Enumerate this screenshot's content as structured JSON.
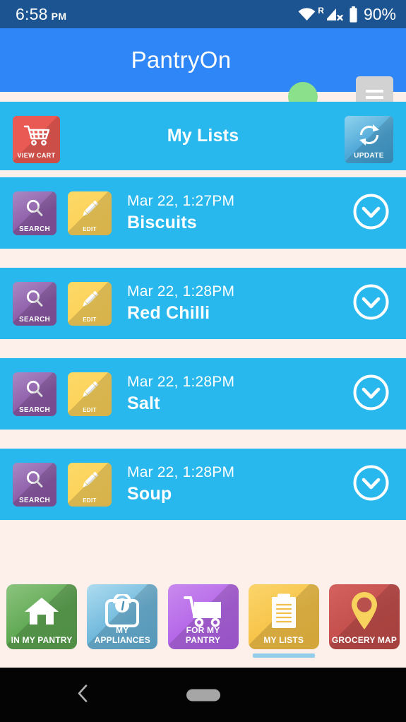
{
  "status_bar": {
    "time": "6:58",
    "ampm": "PM",
    "battery_percent": "90%",
    "wifi_icon": "wifi-icon",
    "roaming_label": "R",
    "signal_icon": "signal-off-icon",
    "battery_icon": "battery-icon",
    "background_color": "#1B5490"
  },
  "title_bar": {
    "app_name": "PantryOn",
    "status_dot_color": "#8BE08B",
    "menu_icon": "hamburger-menu-icon",
    "background_color": "#2E86F7"
  },
  "section_header": {
    "title": "My Lists",
    "background_color": "#28B8EE",
    "view_cart": {
      "label": "VIEW CART",
      "icon": "shopping-cart-icon",
      "color": "#EA5A54"
    },
    "update": {
      "label": "UPDATE",
      "icon": "refresh-sync-icon",
      "color": "#4FA8D8"
    }
  },
  "lists": {
    "row_action_search": {
      "label": "SEARCH",
      "icon": "magnifier-icon"
    },
    "row_action_edit": {
      "label": "EDIT",
      "icon": "pen-icon"
    },
    "expand_icon": "chevron-down-circle-icon",
    "items": [
      {
        "date": "Mar 22, 1:27PM",
        "name": "Biscuits"
      },
      {
        "date": "Mar 22, 1:28PM",
        "name": "Red Chilli"
      },
      {
        "date": "Mar 22, 1:28PM",
        "name": "Salt"
      },
      {
        "date": "Mar 22, 1:28PM",
        "name": "Soup"
      }
    ]
  },
  "tab_bar": {
    "active_index": 3,
    "active_indicator_color": "#93CDE8",
    "tabs": [
      {
        "label": "IN MY PANTRY",
        "icon": "house-icon",
        "color": "#5FA853"
      },
      {
        "label": "MY APPLIANCES",
        "icon": "weight-scale-icon",
        "color": "#6FB8DC"
      },
      {
        "label": "FOR MY PANTRY",
        "icon": "shopping-cart-icon",
        "color": "#B567E8"
      },
      {
        "label": "MY LISTS",
        "icon": "clipboard-icon",
        "color": "#F7C449"
      },
      {
        "label": "GROCERY MAP",
        "icon": "map-pin-icon",
        "color": "#C44F4C"
      }
    ]
  },
  "nav_bar": {
    "back_icon": "back-chevron-icon",
    "home_icon": "home-pill-icon",
    "background_color": "#040404"
  }
}
